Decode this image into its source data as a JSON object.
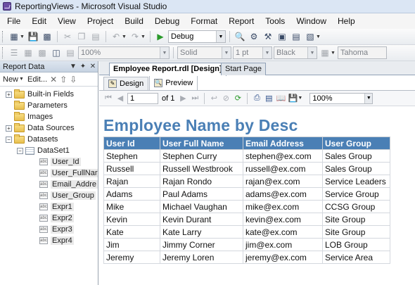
{
  "window": {
    "title": "ReportingViews - Microsoft Visual Studio"
  },
  "menu": [
    "File",
    "Edit",
    "View",
    "Project",
    "Build",
    "Debug",
    "Format",
    "Report",
    "Tools",
    "Window",
    "Help"
  ],
  "toolbar1": {
    "config": "Debug"
  },
  "toolbar2": {
    "zoom": "100%",
    "border_style": "Solid",
    "border_width": "1 pt",
    "border_color": "Black",
    "font": "Tahoma"
  },
  "report_data": {
    "title": "Report Data",
    "new_label": "New",
    "edit_label": "Edit...",
    "nodes": [
      "Built-in Fields",
      "Parameters",
      "Images",
      "Data Sources",
      "Datasets"
    ],
    "dataset": "DataSet1",
    "fields": [
      "User_Id",
      "User_FullNar",
      "Email_Addre",
      "User_Group",
      "Expr1",
      "Expr2",
      "Expr3",
      "Expr4"
    ]
  },
  "tabs": {
    "active": "Employee Report.rdl [Design]",
    "inactive": "Start Page"
  },
  "view_tabs": {
    "design": "Design",
    "preview": "Preview"
  },
  "report_toolbar": {
    "page": "1",
    "of_label": "of 1",
    "zoom": "100%"
  },
  "report": {
    "title": "Employee Name by Desc",
    "columns": [
      "User Id",
      "User Full Name",
      "Email Address",
      "User Group"
    ],
    "rows": [
      [
        "Stephen",
        "Stephen Curry",
        "stephen@ex.com",
        "Sales Group"
      ],
      [
        "Russell",
        "Russell Westbrook",
        "russell@ex.com",
        "Sales Group"
      ],
      [
        "Rajan",
        "Rajan Rondo",
        "rajan@ex.com",
        "Service Leaders"
      ],
      [
        "Adams",
        "Paul Adams",
        "adams@ex.com",
        "Service Group"
      ],
      [
        "Mike",
        "Michael Vaughan",
        "mike@ex.com",
        "CCSG Group"
      ],
      [
        "Kevin",
        "Kevin Durant",
        "kevin@ex.com",
        "Site Group"
      ],
      [
        "Kate",
        "Kate Larry",
        "kate@ex.com",
        "Site Group"
      ],
      [
        "Jim",
        "Jimmy Corner",
        "jim@ex.com",
        "LOB Group"
      ],
      [
        "Jeremy",
        "Jeremy Loren",
        "jeremy@ex.com",
        "Service Area"
      ]
    ]
  }
}
